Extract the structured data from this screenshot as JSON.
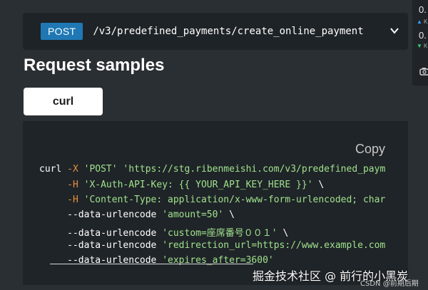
{
  "endpoint": {
    "method": "POST",
    "path": "/v3/predefined_payments/create_online_payment"
  },
  "right_panel": {
    "top_value": "0.",
    "bottom_value": "0.",
    "up_arrow_color": "#3aa0ff",
    "down_arrow_color": "#3ccf6a"
  },
  "section_title": "Request samples",
  "tabs": [
    {
      "label": "curl"
    }
  ],
  "code": {
    "copy_label": "Copy",
    "lines": [
      [
        {
          "t": "plain",
          "v": "curl "
        },
        {
          "t": "flag",
          "v": "-X"
        },
        {
          "t": "plain",
          "v": " "
        },
        {
          "t": "str",
          "v": "'POST'"
        },
        {
          "t": "plain",
          "v": " "
        },
        {
          "t": "str",
          "v": "'https://stg.ribenmeishi.com/v3/predefined_paym"
        }
      ],
      [
        {
          "t": "plain",
          "v": "     "
        },
        {
          "t": "flag",
          "v": "-H"
        },
        {
          "t": "plain",
          "v": " "
        },
        {
          "t": "str",
          "v": "'X-Auth-API-Key: {{ YOUR_API_KEY_HERE }}'"
        },
        {
          "t": "plain",
          "v": " \\"
        }
      ],
      [
        {
          "t": "plain",
          "v": "     "
        },
        {
          "t": "flag",
          "v": "-H"
        },
        {
          "t": "plain",
          "v": " "
        },
        {
          "t": "str",
          "v": "'Content-Type: application/x-www-form-urlencoded; char"
        }
      ],
      [
        {
          "t": "plain",
          "v": "     --data-urlencode "
        },
        {
          "t": "str",
          "v": "'amount=50'"
        },
        {
          "t": "plain",
          "v": " \\"
        }
      ],
      [
        {
          "t": "plain",
          "v": "     --data-urlencode "
        },
        {
          "t": "str",
          "v": "'custom=座席番号００１'"
        },
        {
          "t": "plain",
          "v": " \\"
        }
      ],
      [
        {
          "t": "plain",
          "v": "     --data-urlencode "
        },
        {
          "t": "str",
          "v": "'redirection_url=https://www.example.com"
        }
      ],
      [
        {
          "t": "plain",
          "v": "     --data-urlencode "
        },
        {
          "t": "str",
          "v": "'expires_after=3600'"
        }
      ]
    ]
  },
  "watermark": "掘金技术社区 @ 前行的小黑炭",
  "csdn_mark": "CSDN @前期后期"
}
